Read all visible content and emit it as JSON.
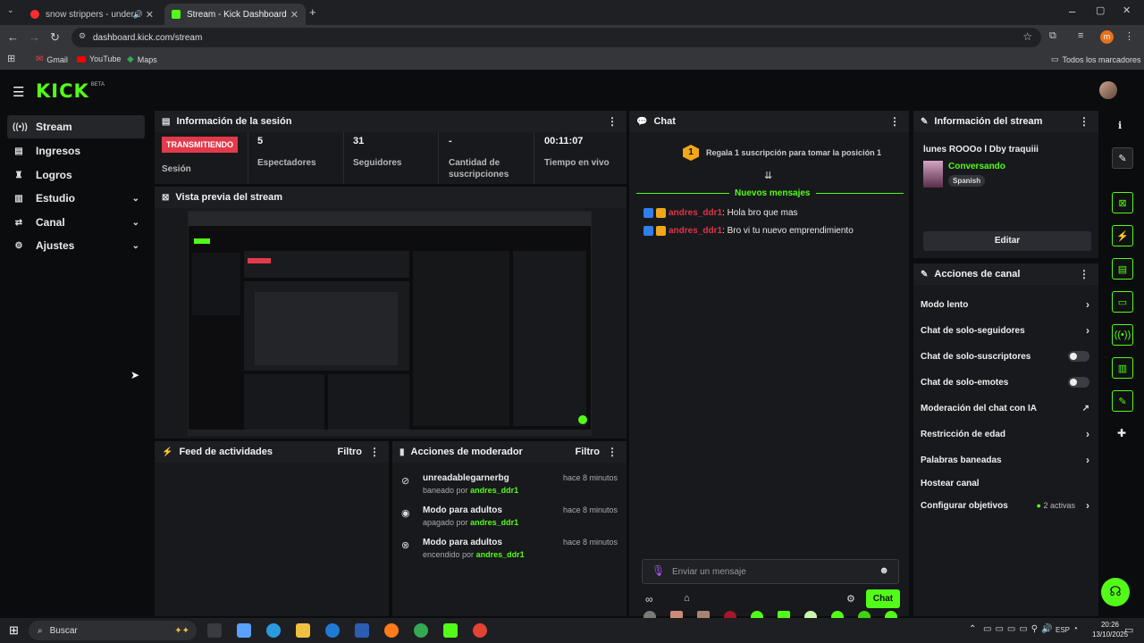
{
  "browser": {
    "tabs": [
      {
        "title": "snow strippers - under you",
        "active": false
      },
      {
        "title": "Stream - Kick Dashboard",
        "active": true
      }
    ],
    "url": "dashboard.kick.com/stream",
    "bookmarks": [
      "Gmail",
      "YouTube",
      "Maps"
    ],
    "all_bookmarks": "Todos los marcadores",
    "profile_initial": "m"
  },
  "brand": {
    "logo": "KICK",
    "beta": "BETA"
  },
  "sidebar": {
    "items": [
      {
        "label": "Stream",
        "icon": "broadcast-icon",
        "active": true
      },
      {
        "label": "Ingresos",
        "icon": "money-icon"
      },
      {
        "label": "Logros",
        "icon": "trophy-icon"
      },
      {
        "label": "Estudio",
        "icon": "studio-icon",
        "expandable": true
      },
      {
        "label": "Canal",
        "icon": "channel-icon",
        "expandable": true
      },
      {
        "label": "Ajustes",
        "icon": "gear-icon",
        "expandable": true
      }
    ]
  },
  "session": {
    "title": "Información de la sesión",
    "live_badge": "TRANSMITIENDO",
    "session_label": "Sesión",
    "stats": [
      {
        "value": "5",
        "label": "Espectadores"
      },
      {
        "value": "31",
        "label": "Seguidores"
      },
      {
        "value": "-",
        "label": "Cantidad de suscripciones"
      },
      {
        "value": "00:11:07",
        "label": "Tiempo en vivo"
      }
    ]
  },
  "preview": {
    "title": "Vista previa del stream"
  },
  "activity": {
    "title": "Feed de actividades",
    "filter": "Filtro"
  },
  "modactions": {
    "title": "Acciones de moderador",
    "filter": "Filtro",
    "items": [
      {
        "title": "unreadablegarnerbg",
        "action": "baneado por",
        "by": "andres_ddr1",
        "time": "hace 8 minutos",
        "icon": "ban-icon"
      },
      {
        "title": "Modo para adultos",
        "action": "apagado por",
        "by": "andres_ddr1",
        "time": "hace 8 minutos",
        "icon": "eye-icon"
      },
      {
        "title": "Modo para adultos",
        "action": "encendido por",
        "by": "andres_ddr1",
        "time": "hace 8 minutos",
        "icon": "eye-off-icon"
      }
    ]
  },
  "chat": {
    "title": "Chat",
    "gift_rank": "1",
    "gift_text": "Regala 1 suscripción para tomar la posición 1",
    "new_messages": "Nuevos mensajes",
    "messages": [
      {
        "user": "andres_ddr1",
        "text": ": Hola bro que mas"
      },
      {
        "user": "andres_ddr1",
        "text": ": Bro vi tu nuevo emprendimiento"
      }
    ],
    "input_placeholder": "Enviar un mensaje",
    "send_label": "Chat"
  },
  "stream_info": {
    "title": "Información del stream",
    "stream_title": "lunes ROOOo l Dby traquiii",
    "category": "Conversando",
    "language": "Spanish",
    "edit_label": "Editar"
  },
  "channel_actions": {
    "title": "Acciones de canal",
    "items": [
      {
        "label": "Modo lento",
        "control": "chevron"
      },
      {
        "label": "Chat de solo-seguidores",
        "control": "chevron"
      },
      {
        "label": "Chat de solo-suscriptores",
        "control": "toggle"
      },
      {
        "label": "Chat de solo-emotes",
        "control": "toggle"
      },
      {
        "label": "Moderación del chat con IA",
        "control": "external"
      },
      {
        "label": "Restricción de edad",
        "control": "chevron"
      },
      {
        "label": "Palabras baneadas",
        "control": "chevron"
      },
      {
        "label": "Hostear canal",
        "control": "none"
      },
      {
        "label": "Configurar objetivos",
        "control": "chevron",
        "extra": "2 activas"
      }
    ]
  },
  "taskbar": {
    "search": "Buscar",
    "lang": "ESP",
    "time": "20:26",
    "date": "13/10/2025"
  },
  "colors": {
    "accent": "#53fc18",
    "live": "#e23a4a",
    "username": "#e0324a"
  }
}
